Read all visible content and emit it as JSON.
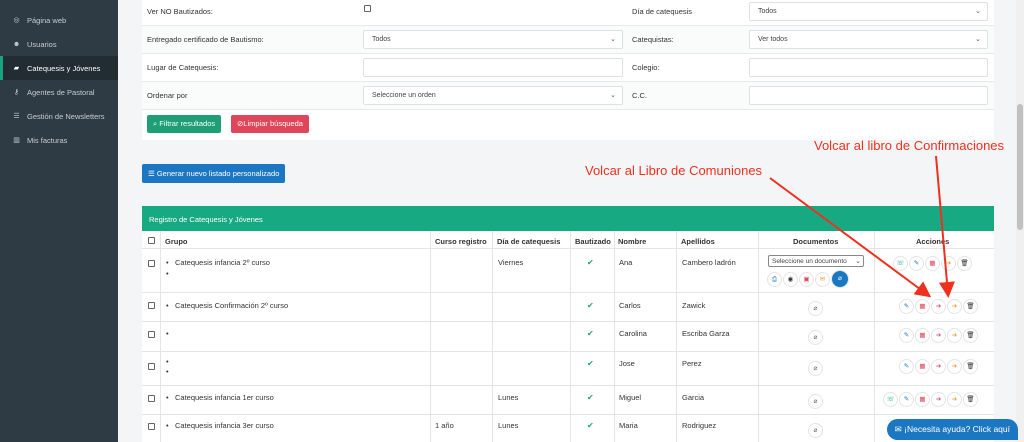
{
  "sidebar": {
    "items": [
      {
        "label": "Página web",
        "icon": "globe-icon"
      },
      {
        "label": "Usuarios",
        "icon": "users-icon"
      },
      {
        "label": "Catequesis y Jóvenes",
        "icon": "book-icon",
        "active": true
      },
      {
        "label": "Agentes de Pastoral",
        "icon": "key-icon"
      },
      {
        "label": "Gestión de Newsletters",
        "icon": "list-icon"
      },
      {
        "label": "Mis facturas",
        "icon": "chart-icon"
      }
    ]
  },
  "filters": {
    "no_bautizados_label": "Ver NO Bautizados:",
    "dia_catequesis_label": "Día de catequesis",
    "dia_catequesis_value": "Todos",
    "certificado_label": "Entregado certificado de Bautismo:",
    "certificado_value": "Todos",
    "catequistas_label": "Catequistas:",
    "catequistas_value": "Ver todos",
    "lugar_label": "Lugar de Catequesis:",
    "lugar_value": "",
    "colegio_label": "Colegio:",
    "colegio_value": "",
    "ordenar_label": "Ordenar por",
    "ordenar_value": "Seleccione un orden",
    "cc_label": "C.C.",
    "cc_value": "",
    "filtrar_button": "Filtrar resultados",
    "limpiar_button": "Limpiar búsqueda",
    "generar_button": "Generar nuevo listado personalizado"
  },
  "annotations": {
    "confirmaciones": "Volcar al libro de Confirmaciones",
    "comuniones": "Volcar al Libro de Comuniones"
  },
  "table": {
    "title": "Registro de Catequesis y Jóvenes",
    "columns": [
      "Grupo",
      "Curso registro",
      "Día de catequesis",
      "Bautizado",
      "Nombre",
      "Apellidos",
      "Documentos",
      "Acciones"
    ],
    "rows": [
      {
        "grupo": [
          "Catequesis infancia 2º curso",
          ""
        ],
        "curso": "",
        "dia": "Viernes",
        "bautizado": true,
        "nombre": "Ana",
        "apellidos": "Cambero ladrón",
        "doc_select": "Seleccione un documento"
      },
      {
        "grupo": [
          "Catequesis Confirmación 2º curso"
        ],
        "curso": "",
        "dia": "",
        "bautizado": true,
        "nombre": "Carlos",
        "apellidos": "Zawick"
      },
      {
        "grupo": [
          ""
        ],
        "curso": "",
        "dia": "",
        "bautizado": true,
        "nombre": "Carolina",
        "apellidos": "Escriba Garza"
      },
      {
        "grupo": [
          "",
          ""
        ],
        "curso": "",
        "dia": "",
        "bautizado": true,
        "nombre": "Jose",
        "apellidos": "Perez"
      },
      {
        "grupo": [
          "Catequesis infancia 1er curso"
        ],
        "curso": "",
        "dia": "Lunes",
        "bautizado": true,
        "nombre": "Miguel",
        "apellidos": "Garcia"
      },
      {
        "grupo": [
          "Catequesis infancia 3er curso"
        ],
        "curso": "1 año",
        "dia": "Lunes",
        "bautizado": true,
        "nombre": "Maria",
        "apellidos": "Rodriguez"
      }
    ]
  },
  "help_button": "¡Necesita ayuda? Click aquí",
  "colors": {
    "accent_green": "#17a982",
    "brand_blue": "#1c77c3",
    "danger_red": "#e0465a",
    "annotation_red": "#f0301f"
  }
}
